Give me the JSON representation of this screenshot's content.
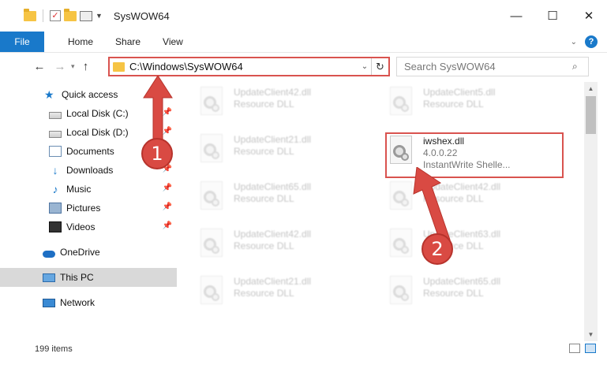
{
  "window": {
    "title": "SysWOW64",
    "controls": {
      "minimize": "—",
      "maximize": "☐",
      "close": "✕"
    }
  },
  "ribbon": {
    "tabs": [
      "File",
      "Home",
      "Share",
      "View"
    ]
  },
  "nav": {
    "address": "C:\\Windows\\SysWOW64",
    "search_placeholder": "Search SysWOW64"
  },
  "sidebar": {
    "items": [
      {
        "label": "Quick access",
        "icon": "star-icon",
        "pinned": false
      },
      {
        "label": "Local Disk (C:)",
        "icon": "drive-icon",
        "pinned": true
      },
      {
        "label": "Local Disk (D:)",
        "icon": "drive-icon",
        "pinned": true
      },
      {
        "label": "Documents",
        "icon": "documents-icon",
        "pinned": true
      },
      {
        "label": "Downloads",
        "icon": "download-icon",
        "pinned": true
      },
      {
        "label": "Music",
        "icon": "music-icon",
        "pinned": true
      },
      {
        "label": "Pictures",
        "icon": "pictures-icon",
        "pinned": true
      },
      {
        "label": "Videos",
        "icon": "videos-icon",
        "pinned": true
      },
      {
        "label": "OneDrive",
        "icon": "onedrive-icon",
        "pinned": false
      },
      {
        "label": "This PC",
        "icon": "pc-icon",
        "pinned": false,
        "selected": true
      },
      {
        "label": "Network",
        "icon": "network-icon",
        "pinned": false
      }
    ]
  },
  "files": {
    "left": [
      {
        "name": "UpdateClient42.dll",
        "sub": "Resource DLL"
      },
      {
        "name": "UpdateClient21.dll",
        "sub": "Resource DLL"
      },
      {
        "name": "UpdateClient65.dll",
        "sub": "Resource DLL"
      },
      {
        "name": "UpdateClient42.dll",
        "sub": "Resource DLL"
      },
      {
        "name": "UpdateClient21.dll",
        "sub": "Resource DLL"
      }
    ],
    "right": [
      {
        "name": "UpdateClient5.dll",
        "sub": "Resource DLL"
      },
      {
        "name": "iwshex.dll",
        "sub": "4.0.0.22",
        "sub2": "InstantWrite Shelle...",
        "highlight": true
      },
      {
        "name": "UpdateClient42.dll",
        "sub": "Resource DLL"
      },
      {
        "name": "UpdateClient63.dll",
        "sub": "Resource DLL"
      },
      {
        "name": "UpdateClient65.dll",
        "sub": "Resource DLL"
      }
    ]
  },
  "status": {
    "item_count": "199 items"
  },
  "annotations": {
    "step1": "1",
    "step2": "2"
  },
  "colors": {
    "accent": "#1979ca",
    "highlight": "#d9534f"
  }
}
